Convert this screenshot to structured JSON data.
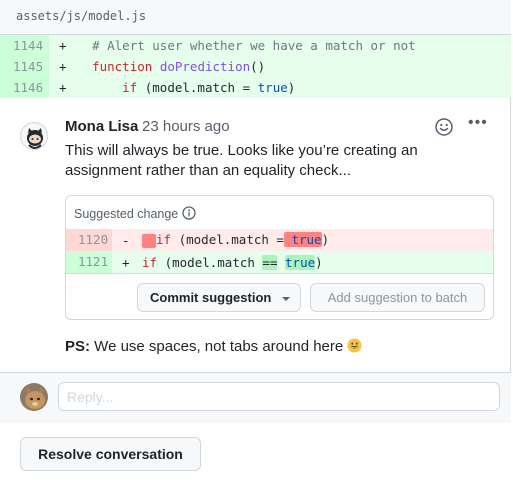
{
  "file": {
    "path": "assets/js/model.js"
  },
  "diff": {
    "lines": [
      {
        "num": "1144",
        "sign": "+",
        "indent": "  ",
        "parts": [
          {
            "t": "# Alert user whether we have a match or not",
            "c": "comment"
          }
        ]
      },
      {
        "num": "1145",
        "sign": "+",
        "indent": "  ",
        "parts": [
          {
            "t": "function",
            "c": "kw"
          },
          {
            "t": " ",
            "c": ""
          },
          {
            "t": "doPrediction",
            "c": "fn"
          },
          {
            "t": "()",
            "c": ""
          }
        ]
      },
      {
        "num": "1146",
        "sign": "+",
        "indent": "      ",
        "parts": [
          {
            "t": "if",
            "c": "kw"
          },
          {
            "t": " (model.match = ",
            "c": ""
          },
          {
            "t": "true",
            "c": "const"
          },
          {
            "t": ")",
            "c": ""
          }
        ]
      }
    ]
  },
  "comment": {
    "author": "Mona Lisa",
    "time": "23 hours ago",
    "reaction_icon": "smiley-icon",
    "more_label": "•••",
    "body": "This will always be true. Looks like you’re creating an assignment rather than an equality check...",
    "suggestion": {
      "title": "Suggested change",
      "deleted": {
        "num": "1120",
        "sign": "-",
        "if_kw": "if",
        "mid": " (model.match =",
        "hl": " true",
        "end": ")"
      },
      "added": {
        "num": "1121",
        "sign": "+",
        "if_kw": "if",
        "mid": " (model.match ",
        "hl_op": "==",
        "sp": " ",
        "hl": "true",
        "end": ")"
      },
      "commit_label": "Commit suggestion",
      "batch_label": "Add suggestion to batch"
    },
    "ps_label": "PS:",
    "ps_text": " We use spaces, not tabs around here ",
    "ps_emoji": "grinning-face"
  },
  "reply": {
    "placeholder": "Reply..."
  },
  "resolve_label": "Resolve conversation",
  "colors": {
    "add_bg": "#e6ffec",
    "del_bg": "#ffebe9",
    "border": "#d0d7de",
    "muted": "#57606a"
  }
}
